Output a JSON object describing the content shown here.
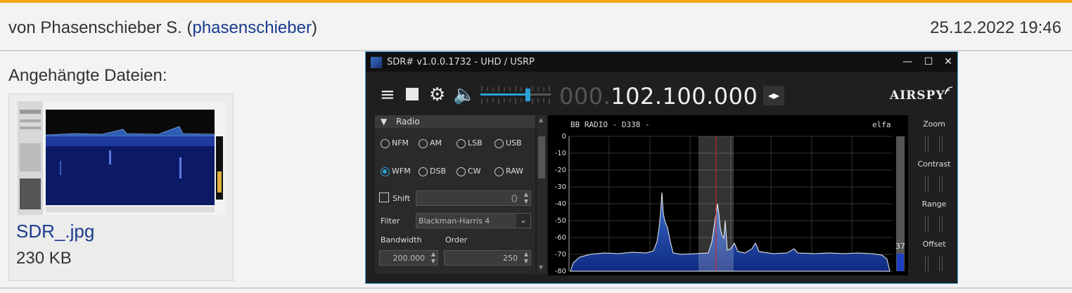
{
  "post": {
    "author_prefix": "von Phasenschieber S. (",
    "author_link": "phasenschieber",
    "author_suffix": ")",
    "date": "25.12.2022 19:46"
  },
  "attachments": {
    "title": "Angehängte Dateien:",
    "files": [
      {
        "name": "SDR_.jpg",
        "size": "230 KB"
      }
    ]
  },
  "sdr": {
    "title": "SDR# v1.0.0.1732 - UHD / USRP",
    "win_min": "—",
    "win_max": "☐",
    "win_close": "✕",
    "freq_prefix": "000.",
    "freq_main": "102.100.000",
    "brand": "AIRSPY",
    "radio_header": "Radio",
    "modes": [
      "NFM",
      "AM",
      "LSB",
      "USB",
      "WFM",
      "DSB",
      "CW",
      "RAW"
    ],
    "selected_mode": "WFM",
    "shift_label": "Shift",
    "shift_value": "0",
    "filter_label": "Filter",
    "filter_value": "Blackman-Harris 4",
    "bandwidth_label": "Bandwidth",
    "bandwidth_value": "200.000",
    "order_label": "Order",
    "order_value": "250",
    "rds_station": "BB RADIO - D338 -",
    "rds_right": "elfa",
    "level_value": "37",
    "zoom_label": "Zoom",
    "contrast_label": "Contrast",
    "range_label": "Range",
    "offset_label": "Offset",
    "y_ticks": [
      "0",
      "-10",
      "-20",
      "-30",
      "-40",
      "-50",
      "-60",
      "-70",
      "-80"
    ]
  }
}
